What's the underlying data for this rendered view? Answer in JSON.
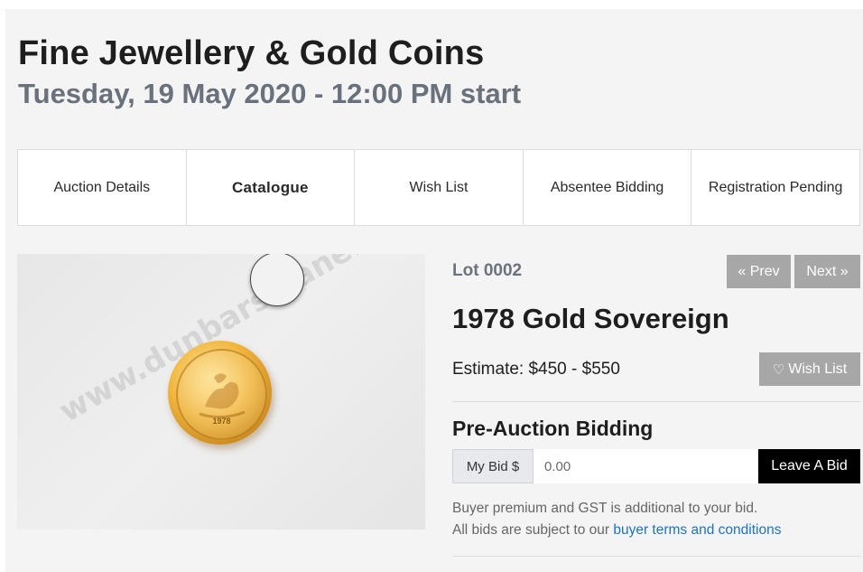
{
  "header": {
    "title": "Fine Jewellery & Gold Coins",
    "subtitle": "Tuesday, 19 May 2020 - 12:00 PM start"
  },
  "tabs": [
    {
      "label": "Auction Details",
      "active": false
    },
    {
      "label": "Catalogue",
      "active": true
    },
    {
      "label": "Wish List",
      "active": false
    },
    {
      "label": "Absentee Bidding",
      "active": false
    },
    {
      "label": "Registration Pending",
      "active": false
    }
  ],
  "image": {
    "watermark": "www.dunbarsloane.co.nz",
    "coin_year": "1978"
  },
  "lot": {
    "label": "Lot 0002",
    "prev_label": "« Prev",
    "next_label": "Next »",
    "title": "1978 Gold Sovereign",
    "estimate": "Estimate: $450 - $550",
    "wish_label": "Wish List"
  },
  "bidding": {
    "heading": "Pre-Auction Bidding",
    "addon_label": "My Bid $",
    "input_placeholder": "0.00",
    "button_label": "Leave A Bid",
    "note_line1": "Buyer premium and GST is additional to your bid.",
    "note_line2_prefix": "All bids are subject to our ",
    "terms_link": "buyer terms and conditions"
  },
  "colors": {
    "accent_link": "#1a73c8",
    "button_grey": "#a7a7a7",
    "subtitle_grey": "#69717c"
  }
}
